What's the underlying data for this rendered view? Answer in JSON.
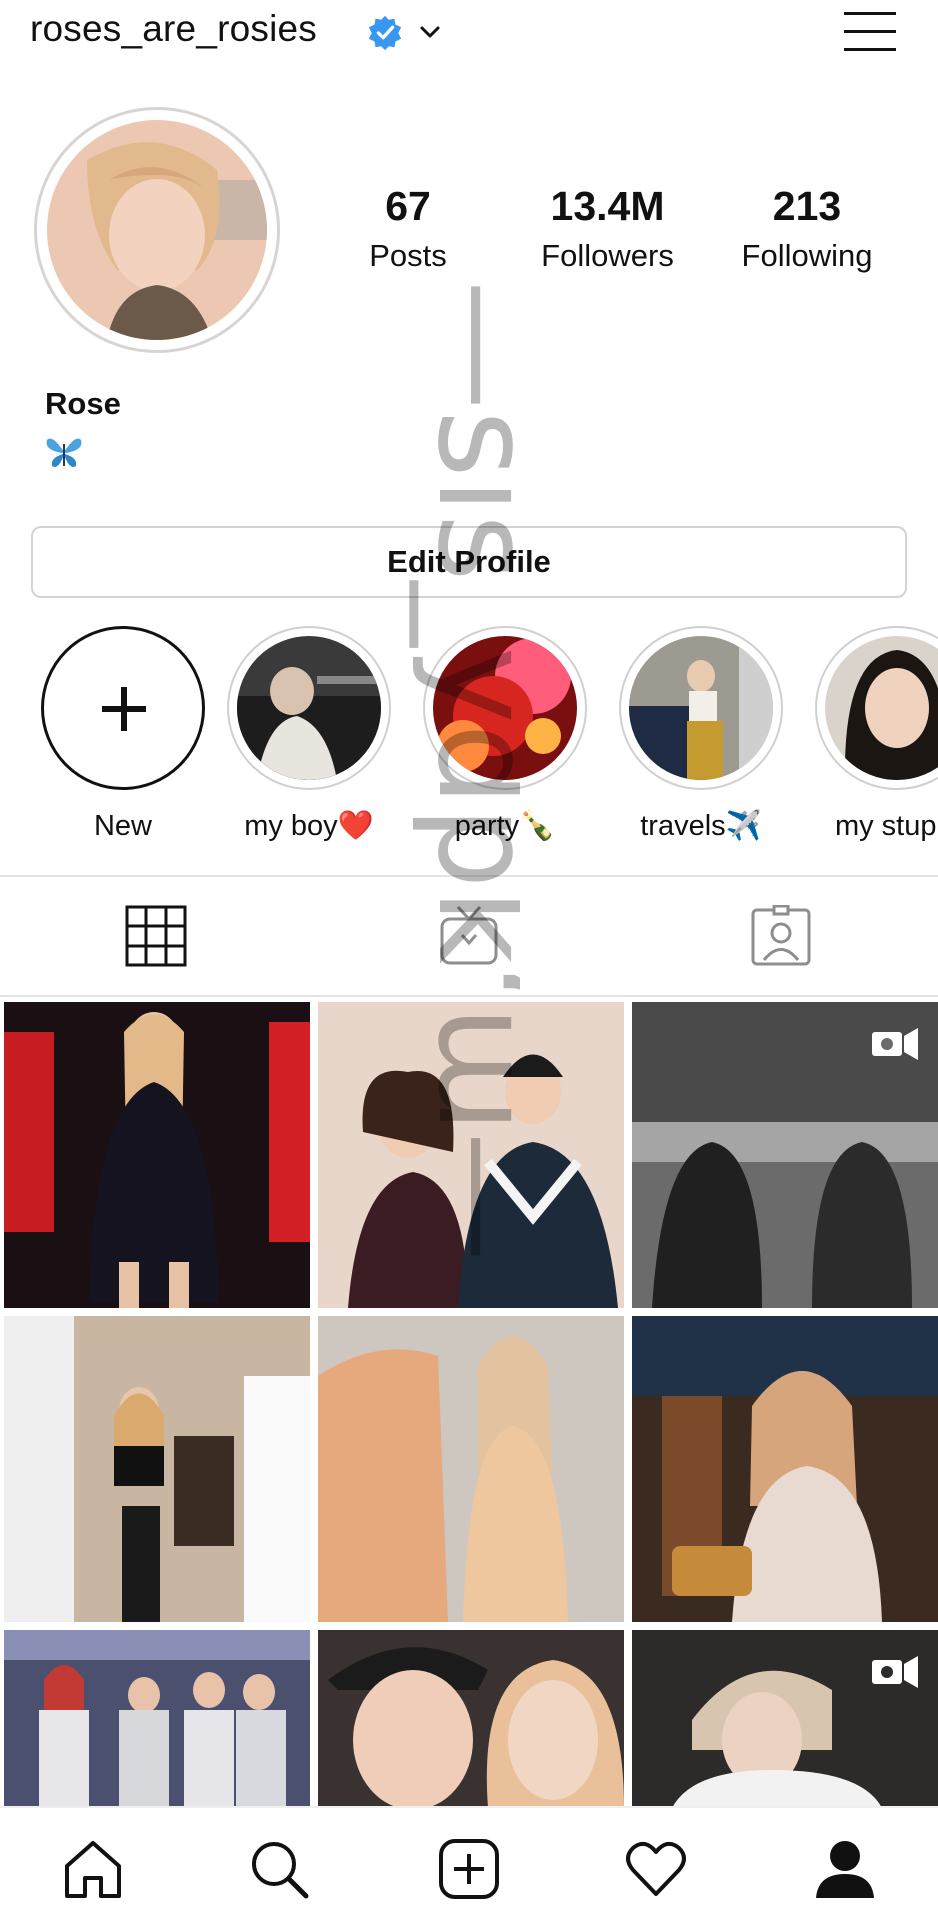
{
  "header": {
    "username": "roses_are_rosies",
    "verified_icon": "verified-badge-icon",
    "dropdown_icon": "chevron-down-icon",
    "menu_icon": "hamburger-menu-icon"
  },
  "profile": {
    "avatar": "profile-photo",
    "display_name": "Rose",
    "bio_emoji": "🦋",
    "stats": {
      "posts": {
        "count": "67",
        "label": "Posts"
      },
      "followers": {
        "count": "13.4M",
        "label": "Followers"
      },
      "following": {
        "count": "213",
        "label": "Following"
      }
    }
  },
  "actions": {
    "edit_profile_label": "Edit Profile"
  },
  "highlights": [
    {
      "label": "New",
      "icon": "plus-icon"
    },
    {
      "label": "my boy❤️"
    },
    {
      "label": "party🍾"
    },
    {
      "label": "travels✈️"
    },
    {
      "label": "my stupid"
    }
  ],
  "tabs": {
    "grid_icon": "grid-icon",
    "igtv_icon": "igtv-icon",
    "tagged_icon": "tagged-icon"
  },
  "bottom_nav": {
    "home_icon": "home-icon",
    "search_icon": "search-icon",
    "new_post_icon": "new-post-icon",
    "activity_icon": "heart-icon",
    "profile_icon": "profile-icon"
  },
  "watermark": {
    "text": "—sis_ydpk‘ɯ—"
  },
  "colors": {
    "verified_blue": "#3897f0",
    "heart_red": "#e0245e",
    "border_gray": "#d3d3d3"
  }
}
